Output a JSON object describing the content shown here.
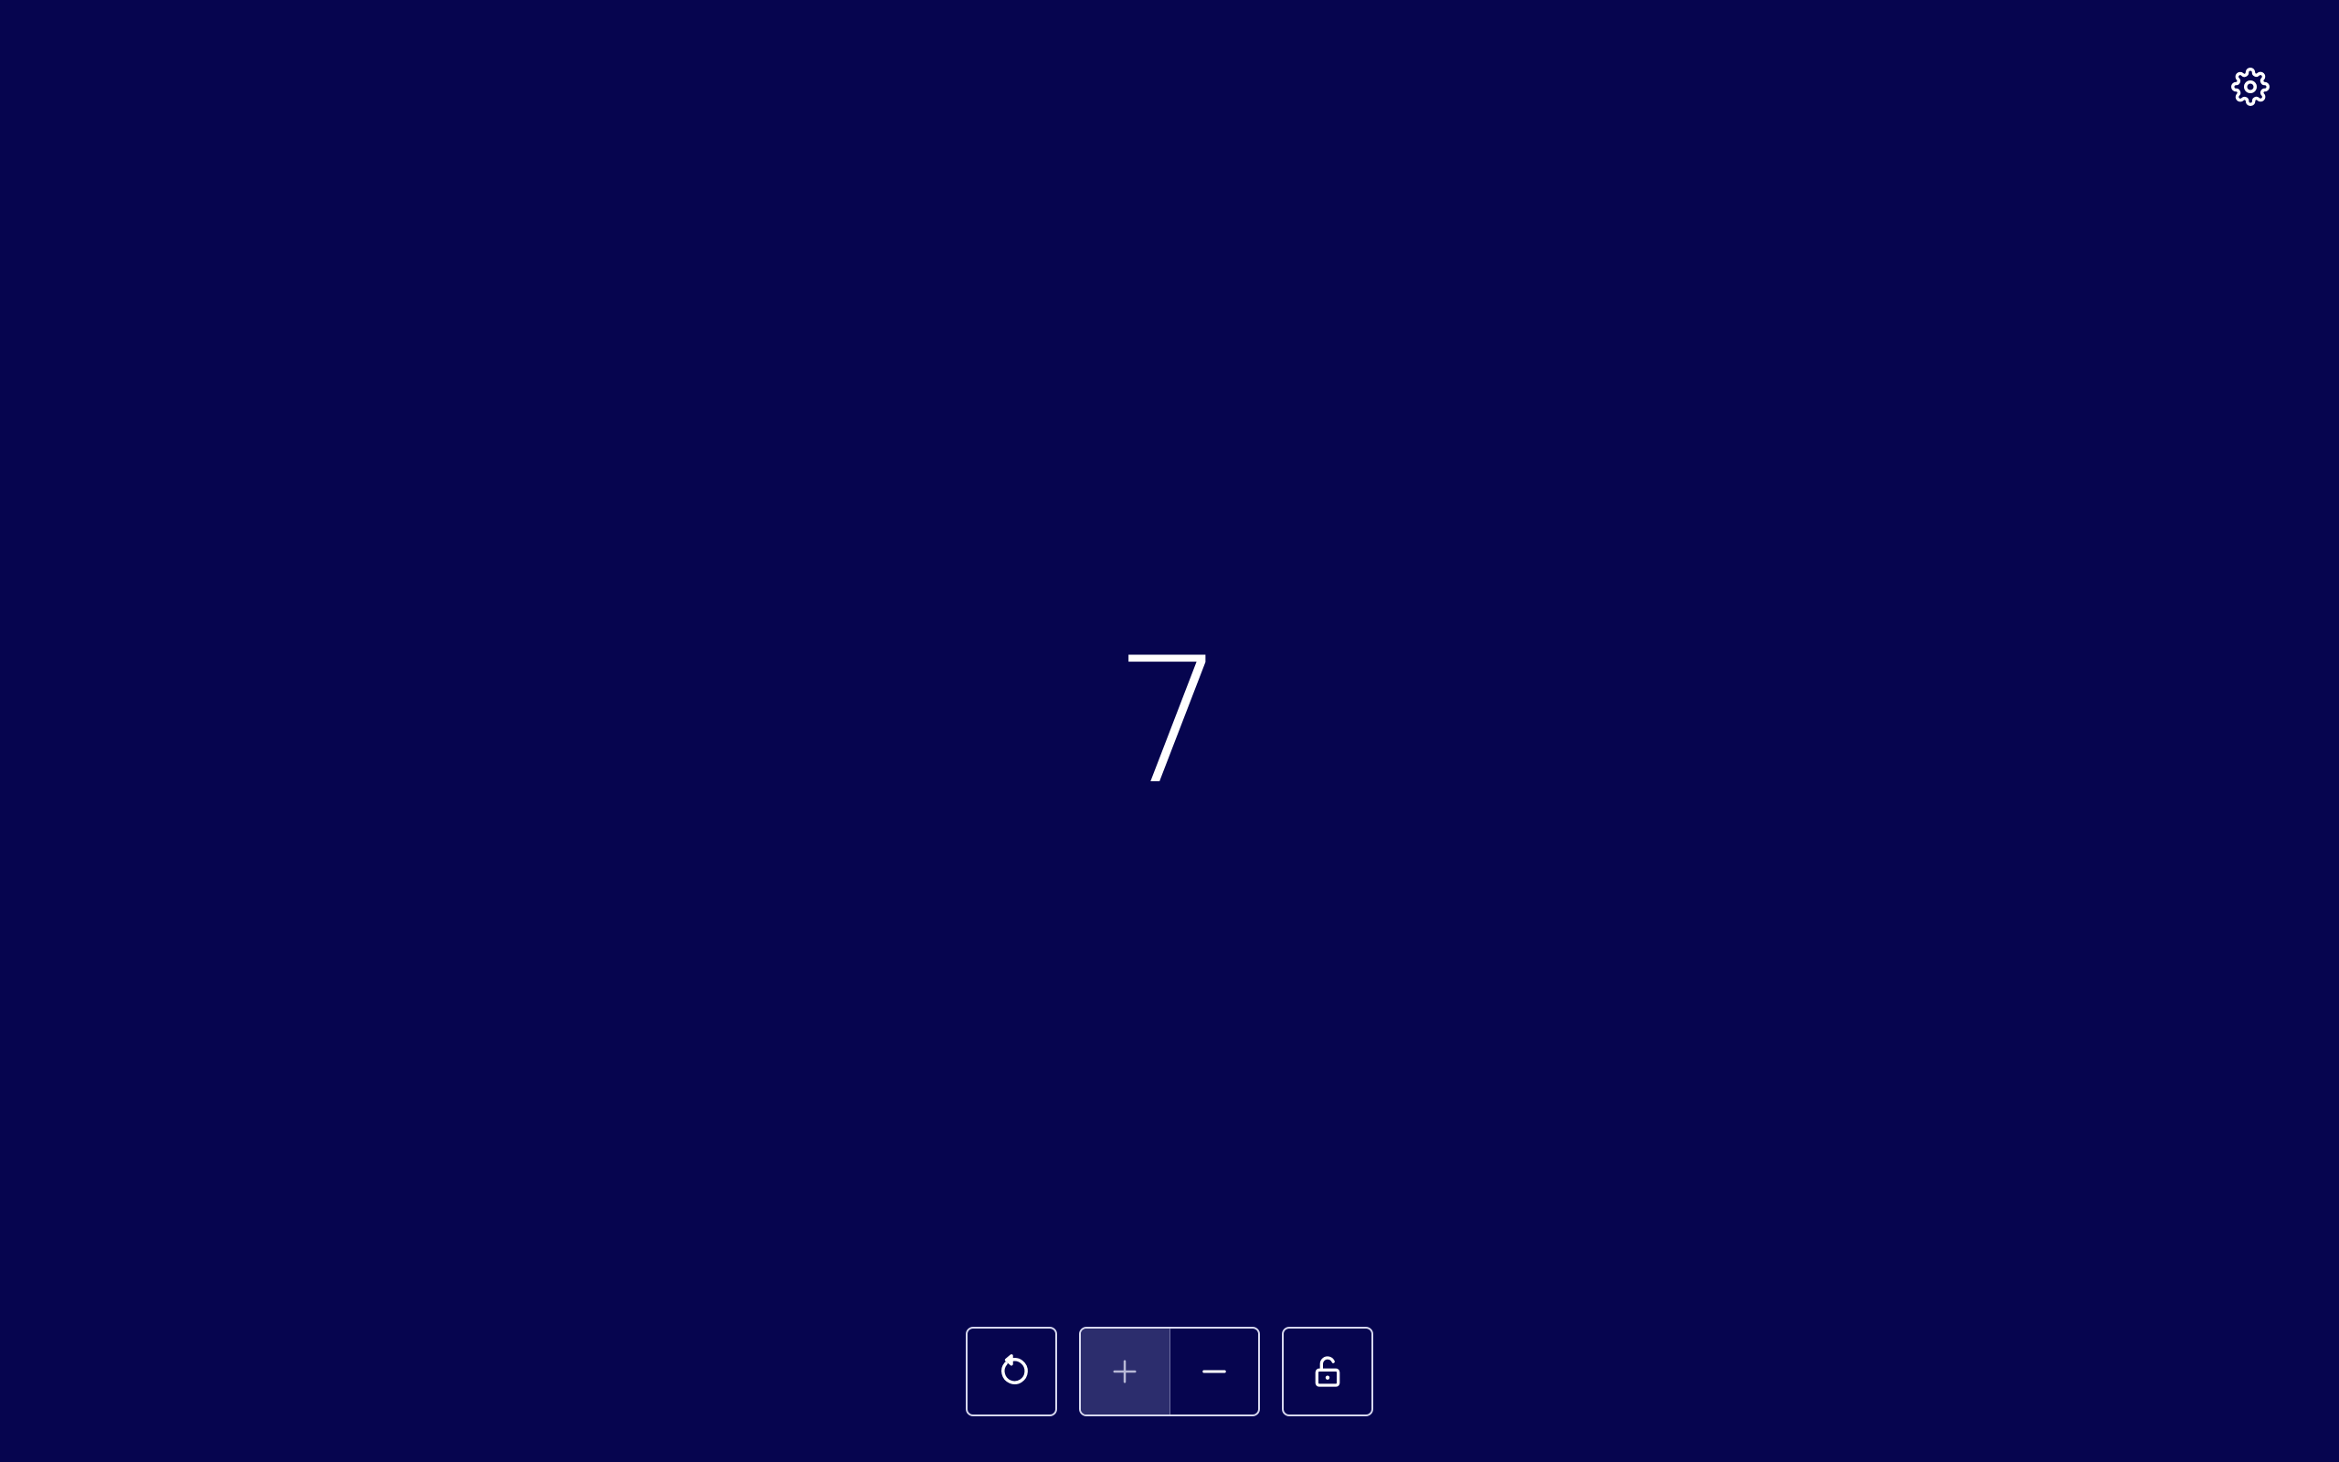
{
  "counter": {
    "value": "7"
  },
  "toolbar": {
    "settings_icon": "gear-icon",
    "reset_icon": "rotate-ccw-icon",
    "increment_icon": "plus-icon",
    "decrement_icon": "minus-icon",
    "lock_icon": "unlocked-padlock-icon",
    "increment_state": "pressed"
  },
  "colors": {
    "background": "#06054f",
    "foreground": "#ffffff",
    "button_border": "#d6d7ee",
    "active_segment": "#2c2d6d"
  }
}
